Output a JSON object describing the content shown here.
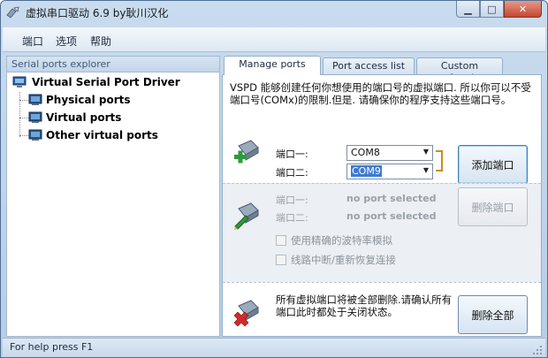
{
  "window": {
    "title": "虚拟串口驱动 6.9 by耿川汉化"
  },
  "menu": {
    "items": [
      "端口",
      "选项",
      "帮助"
    ]
  },
  "explorer": {
    "header": "Serial ports explorer",
    "root": "Virtual Serial Port Driver",
    "children": [
      "Physical ports",
      "Virtual ports",
      "Other virtual ports"
    ]
  },
  "tabs": [
    "Manage ports",
    "Port access list",
    "Custom pinout"
  ],
  "manage": {
    "description": "VSPD 能够创建任何你想使用的端口号的虚拟端口. 所以你可以不受端口号(COMx)的限制.但是. 请确保你的程序支持这些端口号。",
    "add": {
      "port1_label": "端口一:",
      "port2_label": "端口二:",
      "port1_value": "COM8",
      "port2_value": "COM9",
      "button": "添加端口"
    },
    "remove": {
      "port1_label": "端口一:",
      "port2_label": "端口二:",
      "port1_value": "no port selected",
      "port2_value": "no port selected",
      "button": "删除端口",
      "check1": "使用精确的波特率模拟",
      "check2": "线路中断/重新恢复连接"
    },
    "delete_all": {
      "text": "所有虚拟端口将被全部删除.请确认所有端口此时都处于关闭状态。",
      "button": "删除全部"
    }
  },
  "status": {
    "text": "For help press F1"
  },
  "colors": {
    "accent": "#3d7bd2",
    "bracket": "#c98e1c",
    "close": "#c6472f"
  }
}
